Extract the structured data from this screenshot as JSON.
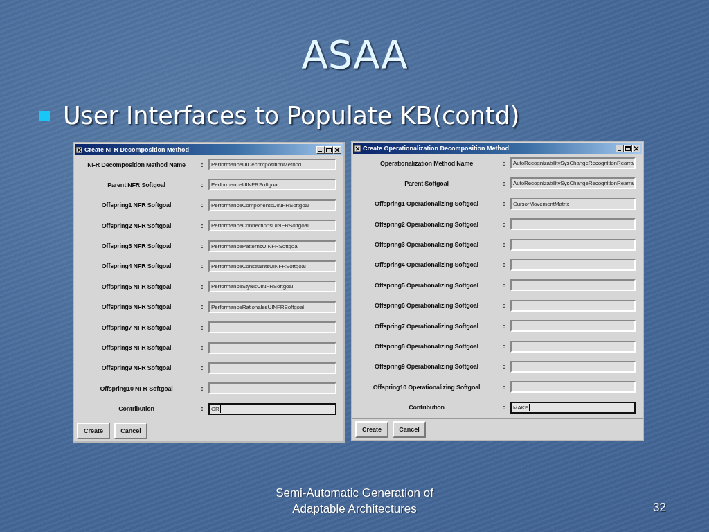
{
  "slide": {
    "title": "ASAA",
    "bullets": [
      {
        "text": "User Interfaces to Populate KB(contd)"
      }
    ],
    "windows": [
      {
        "title": "Create NFR Decomposition Method",
        "fields": [
          {
            "label": "NFR Decomposition Method Name",
            "colon": ":",
            "value": "PerformanceUIDecompositionMethod",
            "focused": false
          },
          {
            "label": "Parent NFR Softgoal",
            "colon": ":",
            "value": "PerformanceUINFRSoftgoal",
            "focused": false
          },
          {
            "label": "Offspring1 NFR Softgoal",
            "colon": ":",
            "value": "PerformanceComponentsUINFRSoftgoal",
            "focused": false
          },
          {
            "label": "Offspring2 NFR Softgoal",
            "colon": ":",
            "value": "PerformanceConnectionsUINFRSoftgoal",
            "focused": false
          },
          {
            "label": "Offspring3 NFR Softgoal",
            "colon": ":",
            "value": "PerformancePatternsUINFRSoftgoal",
            "focused": false
          },
          {
            "label": "Offspring4 NFR Softgoal",
            "colon": ":",
            "value": "PerformanceConstraintsUINFRSoftgoal",
            "focused": false
          },
          {
            "label": "Offspring5 NFR Softgoal",
            "colon": ":",
            "value": "PerformanceStylesUINFRSoftgoal",
            "focused": false
          },
          {
            "label": "Offspring6 NFR Softgoal",
            "colon": ":",
            "value": "PerformanceRationalesUINFRSoftgoal",
            "focused": false
          },
          {
            "label": "Offspring7 NFR Softgoal",
            "colon": ":",
            "focused": false
          },
          {
            "label": "Offspring8 NFR Softgoal",
            "colon": ":",
            "focused": false
          },
          {
            "label": "Offspring9 NFR Softgoal",
            "colon": ":",
            "focused": false
          },
          {
            "label": "Offspring10 NFR Softgoal",
            "colon": ":",
            "focused": false
          },
          {
            "label": "Contribution",
            "colon": ":",
            "value": "OR",
            "focused": true
          }
        ],
        "buttons": [
          "Create",
          "Cancel"
        ]
      },
      {
        "title": "Create Operationalization Decomposition Method",
        "fields": [
          {
            "label": "Operationalization Method Name",
            "colon": ":",
            "value": "AutoRecognizabilitySysChangeRecognitionRearra",
            "focused": false
          },
          {
            "label": "Parent Softgoal",
            "colon": ":",
            "value": "AutoRecognizabilitySysChangeRecognitionRearra",
            "focused": false
          },
          {
            "label": "Offspring1 Operationalizing Softgoal",
            "colon": ":",
            "value": "CursorMovementMatrix",
            "focused": false
          },
          {
            "label": "Offspring2 Operationalizing Softgoal",
            "colon": ":",
            "focused": false
          },
          {
            "label": "Offspring3 Operationalizing Softgoal",
            "colon": ":",
            "focused": false
          },
          {
            "label": "Offspring4 Operationalizing Softgoal",
            "colon": ":",
            "focused": false
          },
          {
            "label": "Offspring5 Operationalizing Softgoal",
            "colon": ":",
            "focused": false
          },
          {
            "label": "Offspring6 Operationalizing Softgoal",
            "colon": ":",
            "focused": false
          },
          {
            "label": "Offspring7 Operationalizing Softgoal",
            "colon": ":",
            "focused": false
          },
          {
            "label": "Offspring8 Operationalizing Softgoal",
            "colon": ":",
            "focused": false
          },
          {
            "label": "Offspring9 Operationalizing Softgoal",
            "colon": ":",
            "focused": false
          },
          {
            "label": "Offspring10 Operationalizing Softgoal",
            "colon": ":",
            "focused": false
          },
          {
            "label": "Contribution",
            "colon": ":",
            "value": "MAKE",
            "focused": true
          }
        ],
        "buttons": [
          "Create",
          "Cancel"
        ]
      }
    ],
    "footer": {
      "text": "Semi-Automatic Generation of\nAdaptable Architectures",
      "page_number": "32"
    }
  }
}
